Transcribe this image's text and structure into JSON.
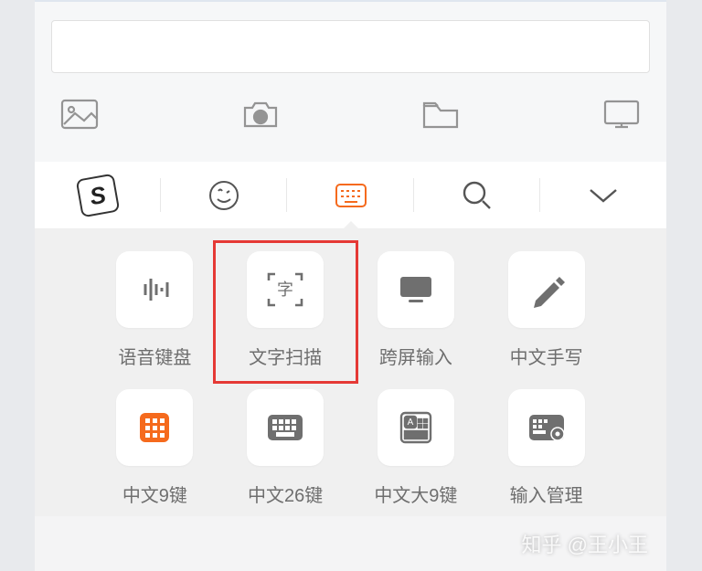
{
  "input": {
    "value": "",
    "placeholder": ""
  },
  "attach_icons": [
    "image-icon",
    "camera-icon",
    "folder-icon",
    "monitor-icon"
  ],
  "ime_tabs": [
    "sogou-logo",
    "emoji-icon",
    "keyboard-icon",
    "search-icon",
    "collapse-icon"
  ],
  "ime_active_index": 2,
  "options": [
    {
      "id": "voice-keyboard",
      "label": "语音键盘",
      "icon": "waveform"
    },
    {
      "id": "text-scan",
      "label": "文字扫描",
      "icon": "scan-char"
    },
    {
      "id": "cross-screen",
      "label": "跨屏输入",
      "icon": "monitor-fill"
    },
    {
      "id": "handwriting",
      "label": "中文手写",
      "icon": "pen"
    },
    {
      "id": "chinese-9key",
      "label": "中文9键",
      "icon": "grid9",
      "accent": true
    },
    {
      "id": "chinese-26key",
      "label": "中文26键",
      "icon": "keyboard"
    },
    {
      "id": "chinese-big9",
      "label": "中文大9键",
      "icon": "keypad-a"
    },
    {
      "id": "input-manage",
      "label": "输入管理",
      "icon": "keyboard-gear"
    }
  ],
  "highlight_index": 1,
  "watermark": "知乎 @王小王",
  "scan_glyph": "字"
}
